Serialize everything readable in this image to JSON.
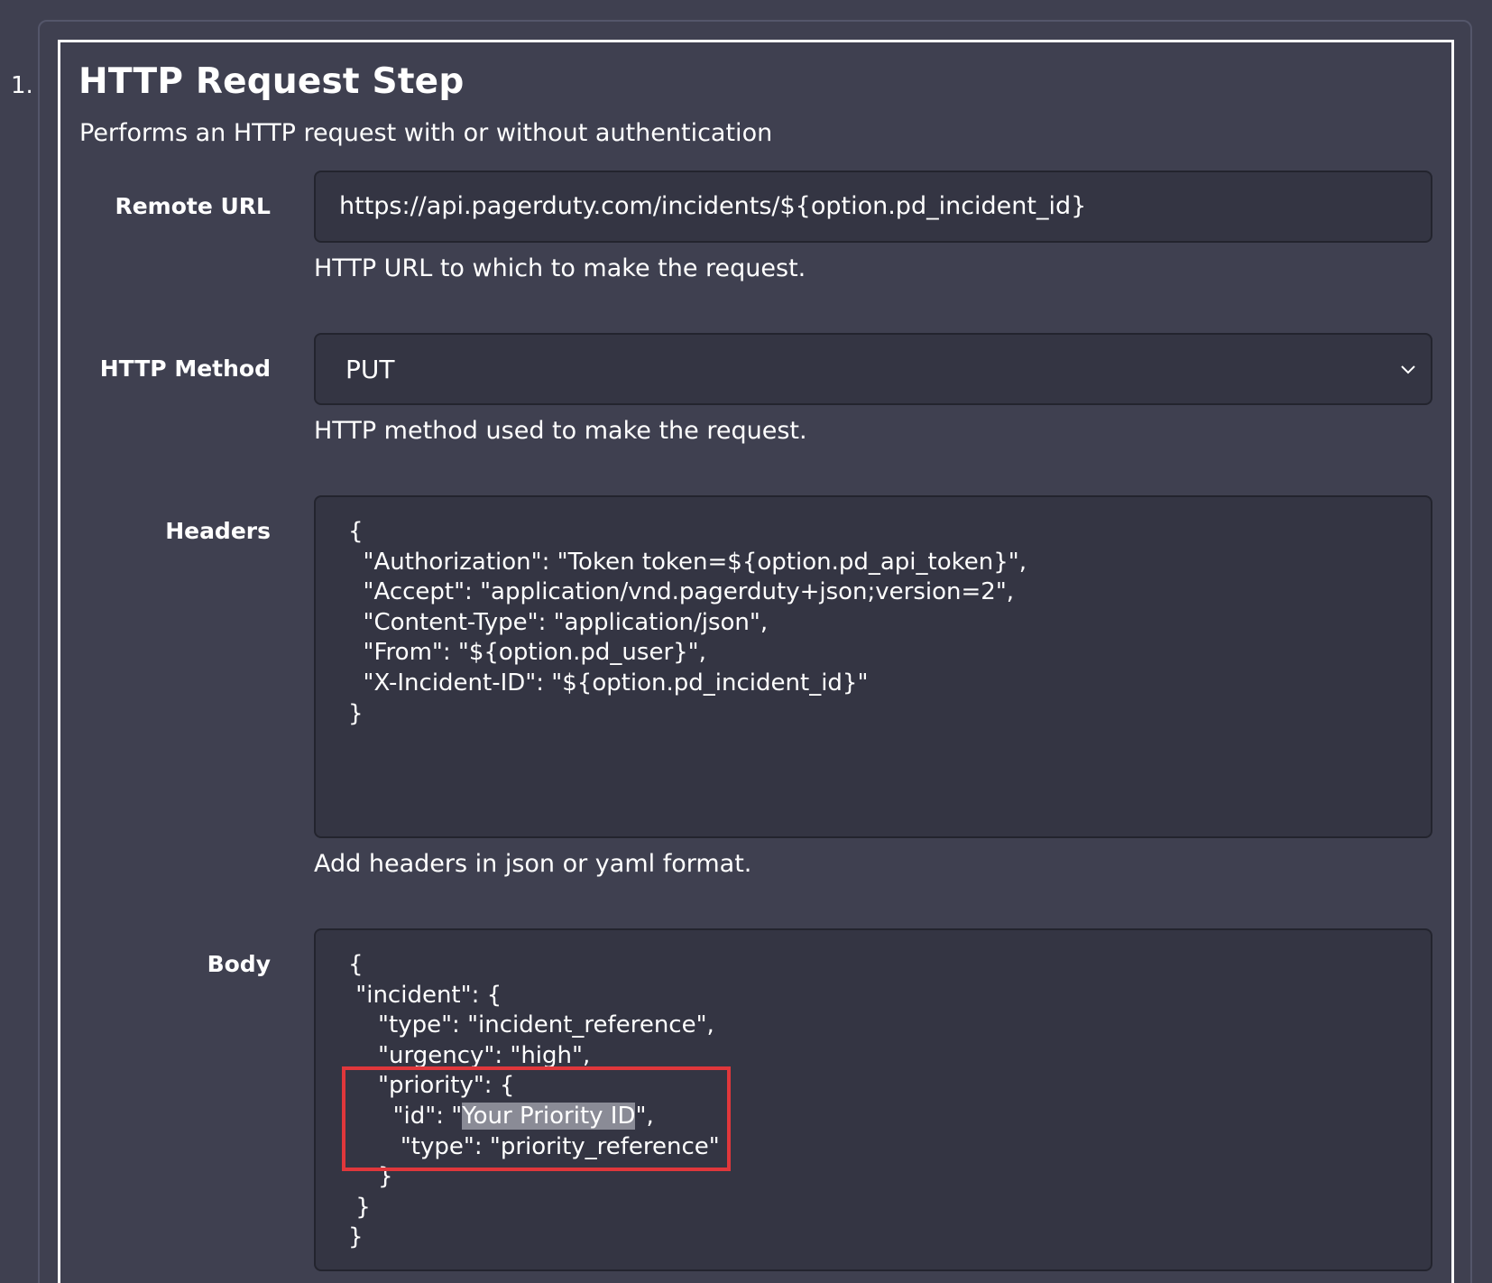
{
  "step": {
    "number": "1.",
    "title": "HTTP Request Step",
    "description": "Performs an HTTP request with or without authentication"
  },
  "remote_url": {
    "label": "Remote URL",
    "value": "https://api.pagerduty.com/incidents/${option.pd_incident_id}",
    "help": "HTTP URL to which to make the request."
  },
  "http_method": {
    "label": "HTTP Method",
    "value": "PUT",
    "help": "HTTP method used to make the request.",
    "chevron_icon": "chevron-down-icon"
  },
  "headers": {
    "label": "Headers",
    "lines": [
      "{",
      "  \"Authorization\": \"Token token=${option.pd_api_token}\",",
      "  \"Accept\": \"application/vnd.pagerduty+json;version=2\",",
      "  \"Content-Type\": \"application/json\",",
      "  \"From\": \"${option.pd_user}\",",
      "  \"X-Incident-ID\": \"${option.pd_incident_id}\"",
      "}"
    ],
    "help": "Add headers in json or yaml format."
  },
  "body": {
    "label": "Body",
    "lines": [
      "{",
      " \"incident\": {",
      "    \"type\": \"incident_reference\",",
      "    \"urgency\": \"high\",",
      "    \"priority\": {",
      "      \"id\": \"",
      "       \"type\": \"priority_reference\"",
      "    }",
      " }",
      "}"
    ],
    "selected_text": "Your Priority ID",
    "selected_suffix": "\","
  },
  "colors": {
    "background": "#3f4050",
    "field_background": "#343543",
    "highlight_border": "#e0373b",
    "selection": "#8a8b96"
  }
}
